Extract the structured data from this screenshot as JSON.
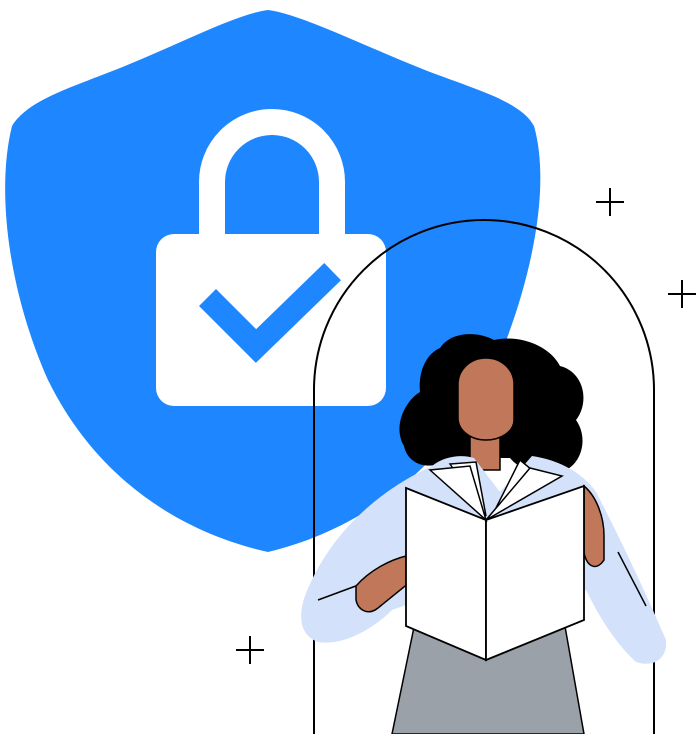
{
  "illustration": {
    "icons": [
      "shield-icon",
      "padlock-icon",
      "checkmark-icon",
      "sparkle-icon"
    ],
    "colors": {
      "shield": "#1E86FF",
      "lock": "#FFFFFF",
      "check": "#1E86FF",
      "skin": "#C1785A",
      "hair": "#000000",
      "shirt": "#D3E1FA",
      "skirt": "#9AA1A8",
      "book": "#FFFFFF",
      "outline": "#000000",
      "background": "#FFFFFF"
    }
  }
}
